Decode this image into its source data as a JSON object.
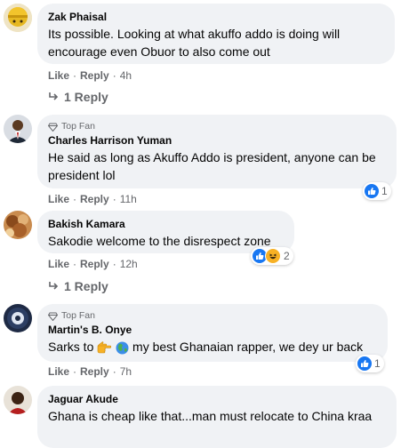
{
  "colors": {
    "bubble": "#f0f2f5",
    "meta": "#65676b",
    "like_blue": "#1877f2"
  },
  "comments": [
    {
      "author": "Zak Phaisal",
      "text": "Its possible. Looking at what akuffo addo is doing will encourage even Obuor to also come out",
      "like_label": "Like",
      "reply_label": "Reply",
      "time": "4h",
      "replies_label": "1 Reply"
    },
    {
      "badge": "Top Fan",
      "author": "Charles Harrison Yuman",
      "text": "He said as long as Akuffo Addo is president, anyone can be president lol",
      "like_label": "Like",
      "reply_label": "Reply",
      "time": "11h",
      "reaction_count": "1"
    },
    {
      "author": "Bakish Kamara",
      "text": "Sakodie welcome to the disrespect zone",
      "like_label": "Like",
      "reply_label": "Reply",
      "time": "12h",
      "reaction_count": "2",
      "replies_label": "1 Reply"
    },
    {
      "badge": "Top Fan",
      "author": "Martin's B. Onye",
      "text_before": "Sarks to",
      "emojis": [
        "backhand-index-pointing-right",
        "globe"
      ],
      "text_after": "my best Ghanaian rapper, we dey ur back",
      "like_label": "Like",
      "reply_label": "Reply",
      "time": "7h",
      "reaction_count": "1"
    },
    {
      "author": "Jaguar Akude",
      "text": "Ghana is cheap like that...man must relocate to China kraa"
    }
  ]
}
